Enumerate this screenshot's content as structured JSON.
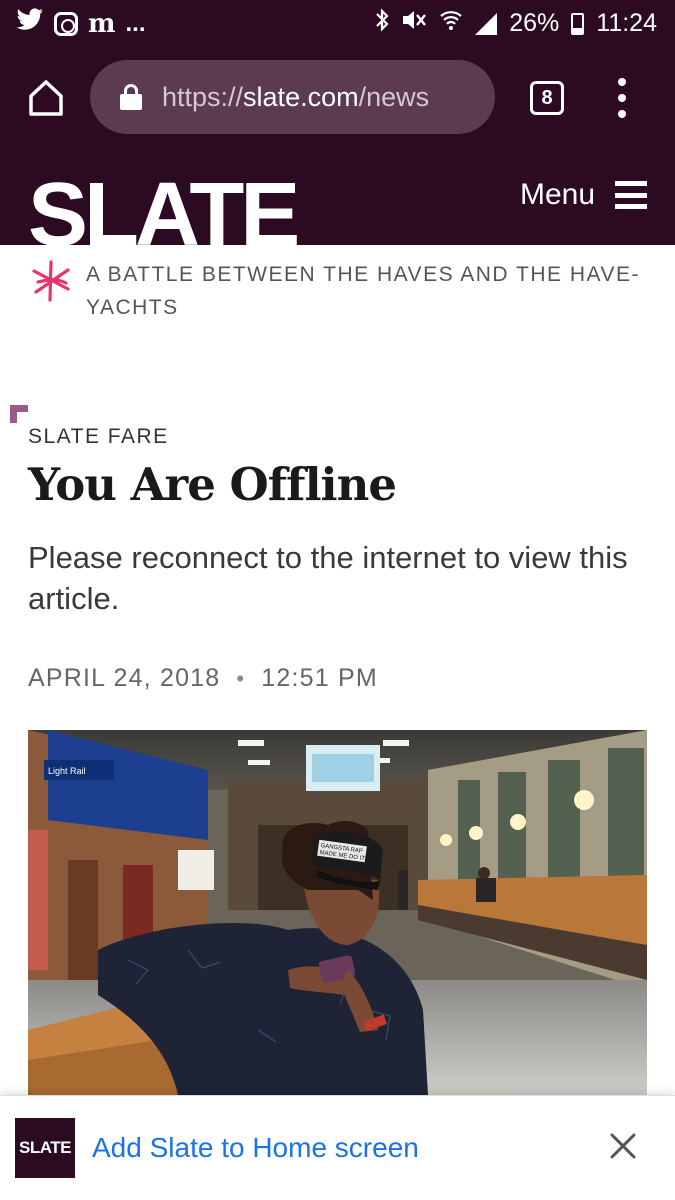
{
  "status_bar": {
    "left_icons": [
      "twitter-icon",
      "instagram-icon",
      "merriam-webster-icon"
    ],
    "ellipsis": "...",
    "battery": "26%",
    "time": "11:24"
  },
  "browser": {
    "url_scheme": "https://",
    "url_host": "slate.com",
    "url_path": "/news",
    "tab_count": "8"
  },
  "site_header": {
    "logo": "SLATE",
    "menu_label": "Menu"
  },
  "promo": {
    "text": "A BATTLE BETWEEN THE HAVES AND THE HAVE-YACHTS"
  },
  "article": {
    "kicker": "SLATE FARE",
    "headline": "You Are Offline",
    "dek": "Please reconnect to the internet to view this article.",
    "date": "APRIL 24, 2018",
    "separator": "•",
    "time": "12:51 PM"
  },
  "photo": {
    "sign_text": "Light Rail",
    "cap_text_line1": "GANGSTA RAP",
    "cap_text_line2": "MADE ME DO IT"
  },
  "install_prompt": {
    "logo": "SLATE",
    "text": "Add Slate to Home screen"
  },
  "colors": {
    "brand_dark": "#2c0a22",
    "url_bar": "#5b3a52",
    "accent_pink": "#e8336d",
    "link_blue": "#1a73e8"
  }
}
